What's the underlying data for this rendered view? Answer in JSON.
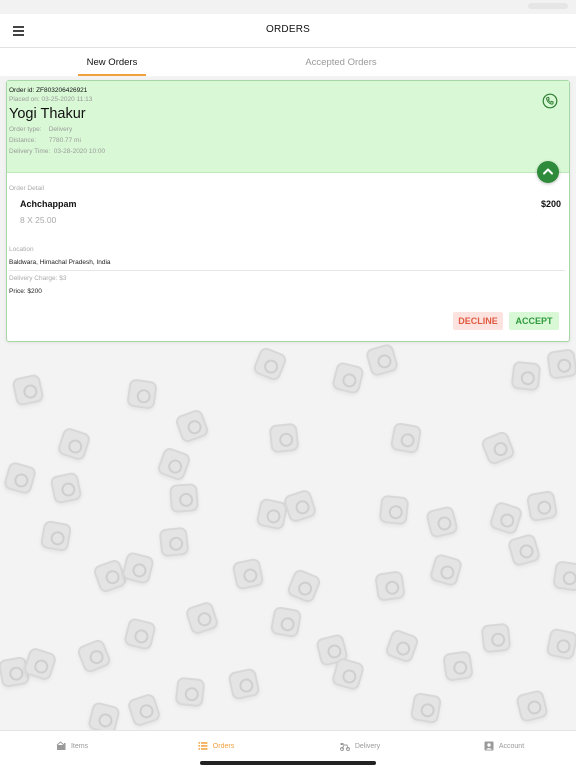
{
  "header": {
    "title": "ORDERS"
  },
  "tabs": [
    {
      "label": "New Orders",
      "active": true
    },
    {
      "label": "Accepted Orders",
      "active": false
    }
  ],
  "order": {
    "order_id_line": "Order id:  ZF803206426921",
    "placed_on_line": "Placed on: 03-25-2020 11:13",
    "customer_name": "Yogi Thakur",
    "order_type_line": "Order type:    Delivery",
    "distance_line": "Distance:       7780.77 mi",
    "delivery_time_line": "Delivery Time:  03-28-2020 10:00",
    "detail_label": "Order Detail",
    "items": [
      {
        "name": "Achchappam",
        "qty": "8 X 25.00",
        "price": "$200"
      }
    ],
    "location_label": "Location",
    "location_value": "Baldwara, Himachal Pradesh, India",
    "delivery_charge_line": "Delivery Charge: $3",
    "price_line": "Price: $200",
    "decline_label": "DECLINE",
    "accept_label": "ACCEPT"
  },
  "bottom_nav": [
    {
      "label": "Items",
      "icon": "items-icon",
      "active": false
    },
    {
      "label": "Orders",
      "icon": "orders-icon",
      "active": true
    },
    {
      "label": "Delivery",
      "icon": "delivery-icon",
      "active": false
    },
    {
      "label": "Account",
      "icon": "account-icon",
      "active": false
    }
  ],
  "colors": {
    "accent": "#f0a03c",
    "card_header": "#d9f9d6",
    "accept_green": "#2f9a3e",
    "decline_red": "#e05a40",
    "collapse_button": "#2e8b3c"
  }
}
